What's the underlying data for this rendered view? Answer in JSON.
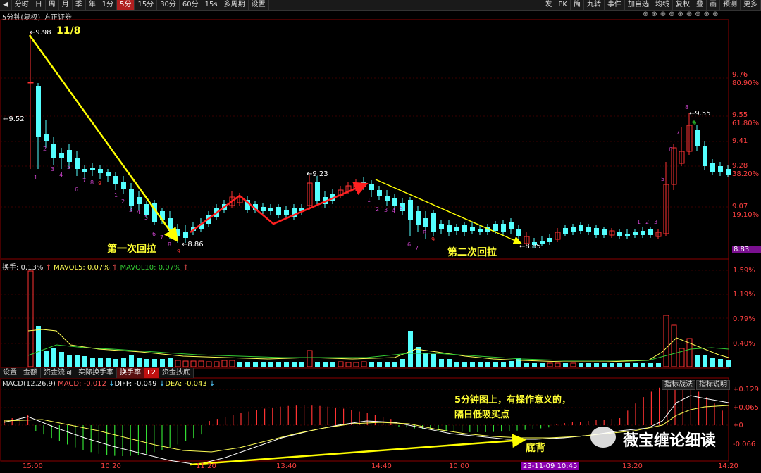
{
  "toolbar": {
    "left_items": [
      "分时",
      "日",
      "周",
      "月",
      "季",
      "年",
      "1分",
      "5分",
      "15分",
      "30分",
      "60分",
      "15s",
      "多周期",
      "设置"
    ],
    "active_item": "5分",
    "right_items": [
      "发",
      "PK",
      "筒",
      "九转",
      "事件",
      "加自选",
      "均线",
      "复权",
      "叠",
      "画",
      "预测",
      "更多"
    ]
  },
  "header": {
    "title": "5分钟(复权)",
    "broker": "方正证券"
  },
  "price_labels": {
    "high_mark": "9.98",
    "date_mark": "11/8",
    "open_mark": "9.52",
    "low1_mark": "8.86",
    "mid_mark": "9.23",
    "low2_mark": "8.85",
    "right_high_mark": "9.55"
  },
  "y_axis_right": [
    {
      "price": "9.76",
      "pct": "80.90%"
    },
    {
      "price": "9.55",
      "pct": "61.80%"
    },
    {
      "price": "9.41",
      "pct": ""
    },
    {
      "price": "9.28",
      "pct": "38.20%"
    },
    {
      "price": "9.07",
      "pct": "19.10%"
    },
    {
      "price": "8.83",
      "pct": ""
    }
  ],
  "annotations": {
    "first_pullback": "第一次回拉",
    "second_pullback": "第二次回拉",
    "note_line1": "5分钟图上，有操作意义的，",
    "note_line2": "隔日低吸买点",
    "divergence": "底背",
    "watermark": "薇宝缠论细读"
  },
  "volume_panel": {
    "legend_turnover": "换手: 0.13%",
    "legend_mavol5": "MAVOL5: 0.07%",
    "legend_mavol10": "MAVOL10: 0.07%",
    "y_labels": [
      "1.59%",
      "1.19%",
      "0.79%",
      "0.40%"
    ]
  },
  "panel_tabs": [
    "设置",
    "金额",
    "资金流向",
    "实际换手率",
    "换手率",
    "资金抄底"
  ],
  "panel_tab_badge": "L2",
  "macd_panel": {
    "legend_title": "MACD(12,26,9)",
    "legend_macd": "MACD: -0.012",
    "legend_diff": "DIFF: -0.049",
    "legend_dea": "DEA: -0.043",
    "button_tactics": "指标战法",
    "button_help": "指标说明",
    "y_labels": [
      "+0.129",
      "+0.065",
      "+0",
      "-0.066"
    ]
  },
  "x_axis": [
    "15:00",
    "10:20",
    "11:20",
    "13:40",
    "14:40",
    "10:00",
    "23-11-09 10:45",
    "13:20",
    "14:20"
  ],
  "td_counts_top_left": [
    "1",
    "2",
    "3",
    "4",
    "5",
    "6",
    "7",
    "8",
    "9"
  ],
  "colors": {
    "up": "#ff3232",
    "down": "#54ffff",
    "arrow_yellow": "#ffff00",
    "arrow_red": "#ff2020",
    "axis_red": "#ff4040",
    "macd_highlight": "#8b00b0"
  }
}
